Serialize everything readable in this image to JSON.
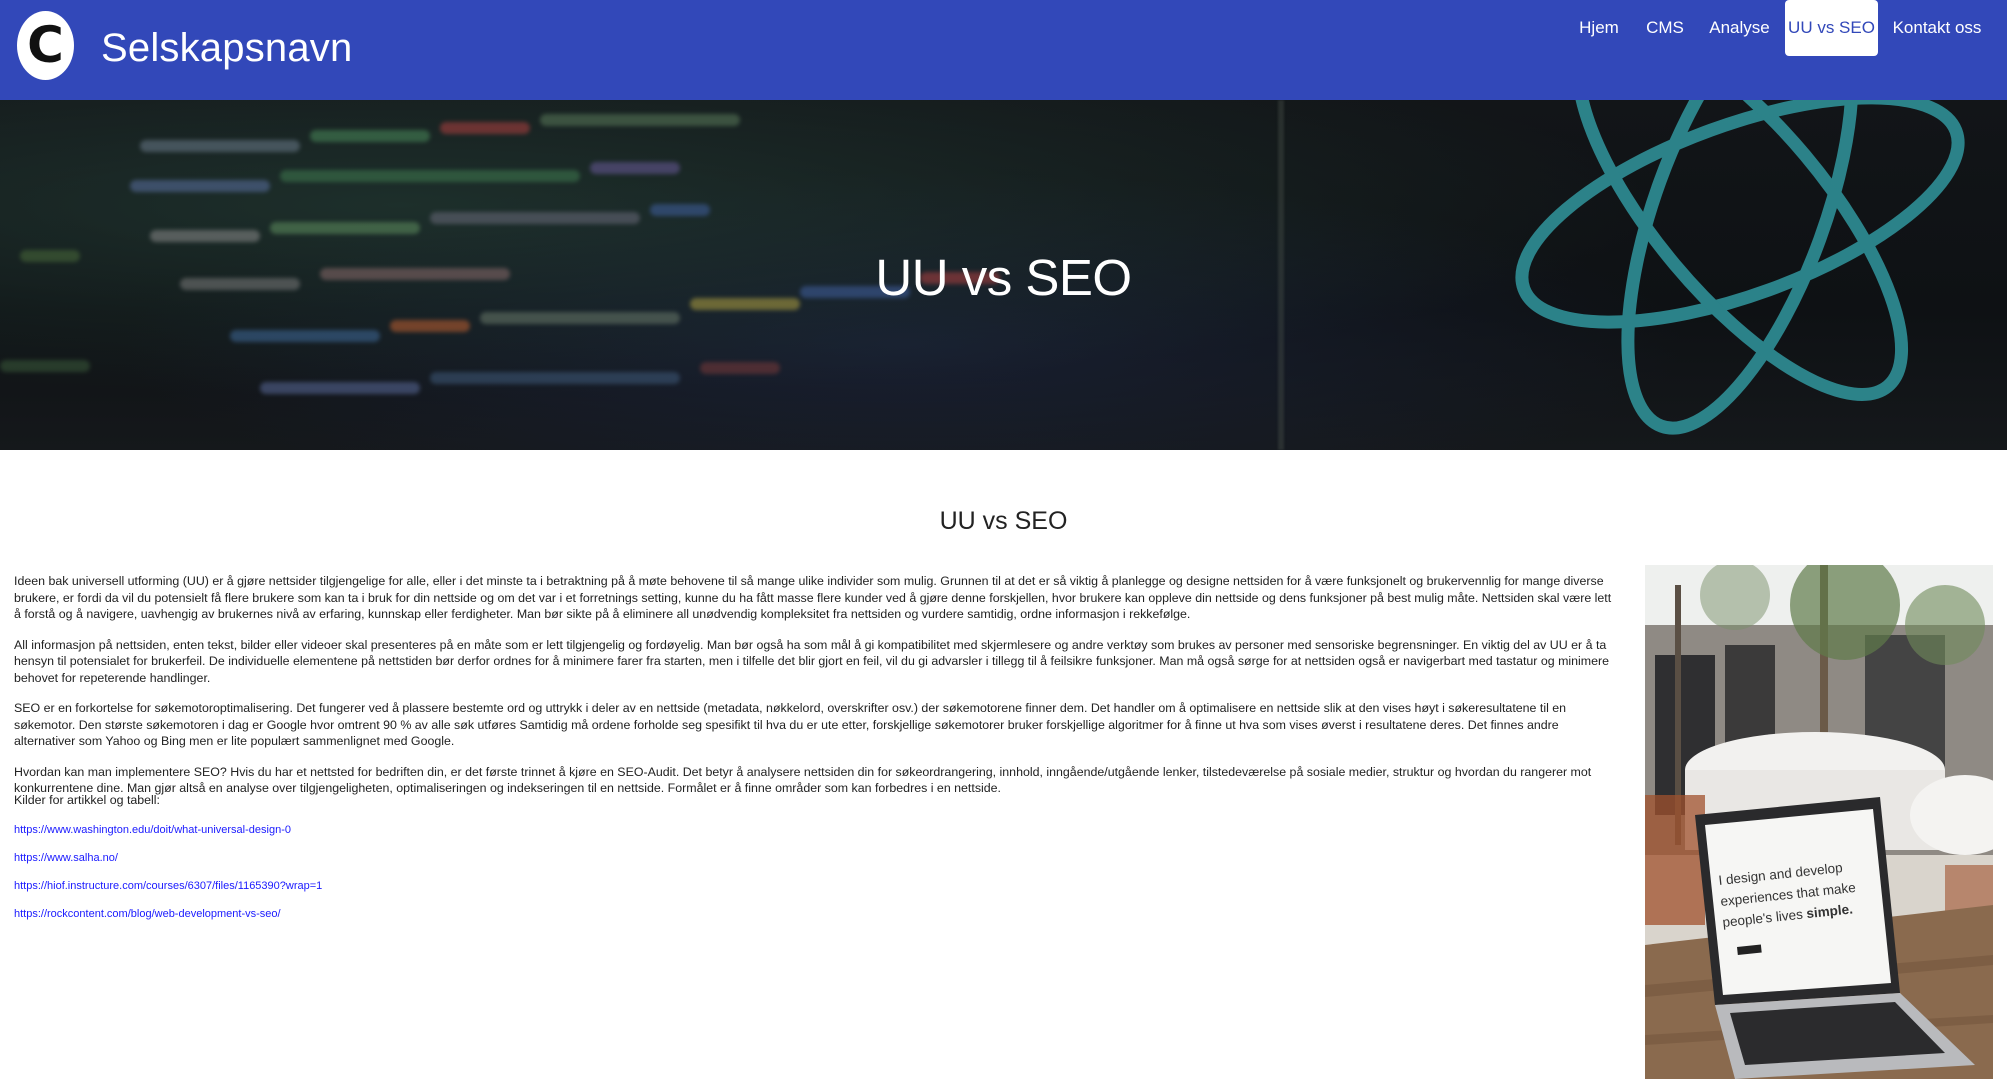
{
  "header": {
    "logo_letter": "C",
    "brand": "Selskapsnavn",
    "nav": [
      {
        "label": "Hjem",
        "active": false
      },
      {
        "label": "CMS",
        "active": false
      },
      {
        "label": "Analyse",
        "active": false
      },
      {
        "label": "UU vs SEO",
        "active": true
      },
      {
        "label": "Kontakt oss",
        "active": false
      }
    ],
    "colors": {
      "navbar": "#3248b9",
      "active_tab_bg": "#ffffff"
    }
  },
  "hero": {
    "title": "UU vs SEO"
  },
  "main": {
    "section_title": "UU vs SEO",
    "paragraphs": [
      "Ideen bak universell utforming (UU) er å gjøre nettsider tilgjengelige for alle, eller i det minste ta i betraktning på å møte behovene til så mange ulike individer som mulig. Grunnen til at det er så viktig å planlegge og designe nettsiden for å være funksjonelt og brukervennlig for mange diverse brukere, er fordi da vil du potensielt få flere brukere som kan ta i bruk for din nettside og om det var i et forretnings setting, kunne du ha fått masse flere kunder ved å gjøre denne forskjellen, hvor brukere kan oppleve din nettside og dens funksjoner på best mulig måte. Nettsiden skal være lett å forstå og å navigere, uavhengig av brukernes nivå av erfaring, kunnskap eller ferdigheter. Man bør sikte på å eliminere all unødvendig kompleksitet fra nettsiden og vurdere samtidig, ordne informasjon i rekkefølge.",
      "All informasjon på nettsiden, enten tekst, bilder eller videoer skal presenteres på en måte som er lett tilgjengelig og fordøyelig. Man bør også ha som mål å gi kompatibilitet med skjermlesere og andre verktøy som brukes av personer med sensoriske begrensninger. En viktig del av UU er å ta hensyn til potensialet for brukerfeil. De individuelle elementene på nettstiden bør derfor ordnes for å minimere farer fra starten, men i tilfelle det blir gjort en feil, vil du gi advarsler i tillegg til å feilsikre funksjoner. Man må også sørge for at nettsiden også er navigerbart med tastatur og minimere behovet for repeterende handlinger.",
      "SEO er en forkortelse for søkemotoroptimalisering. Det fungerer ved å plassere bestemte ord og uttrykk i deler av en nettside (metadata, nøkkelord, overskrifter osv.) der søkemotorene finner dem. Det handler om å optimalisere en nettside slik at den vises høyt i søkeresultatene til en søkemotor. Den største søkemotoren i dag er Google hvor omtrent 90 % av alle søk utføres Samtidig må ordene forholde seg spesifikt til hva du er ute etter, forskjellige søkemotorer bruker forskjellige algoritmer for å finne ut hva som vises øverst i resultatene deres. Det finnes andre alternativer som Yahoo og Bing men er lite populært sammenlignet med Google.",
      "Hvordan kan man implementere SEO? Hvis du har et nettsted for bedriften din, er det første trinnet å kjøre en SEO-Audit. Det betyr å analysere nettsiden din for søkeordrangering, innhold, inngående/utgående lenker, tilstedeværelse på sosiale medier, struktur og hvordan du rangerer mot konkurrentene dine. Man gjør altså en analyse over tilgjengeligheten, optimaliseringen og indekseringen til en nettside. Formålet er å finne områder som kan forbedres i en nettside."
    ],
    "sources_label": "Kilder for artikkel og tabell:",
    "sources": [
      "https://www.washington.edu/doit/what-universal-design-0",
      "https://www.salha.no/",
      "https://hiof.instructure.com/courses/6307/files/1165390?wrap=1",
      "https://rockcontent.com/blog/web-development-vs-seo/"
    ]
  },
  "photo": {
    "screen_text_line1": "I design and develop",
    "screen_text_line2": "experiences that make",
    "screen_text_line3_prefix": "people's lives ",
    "screen_text_line3_bold": "simple."
  }
}
